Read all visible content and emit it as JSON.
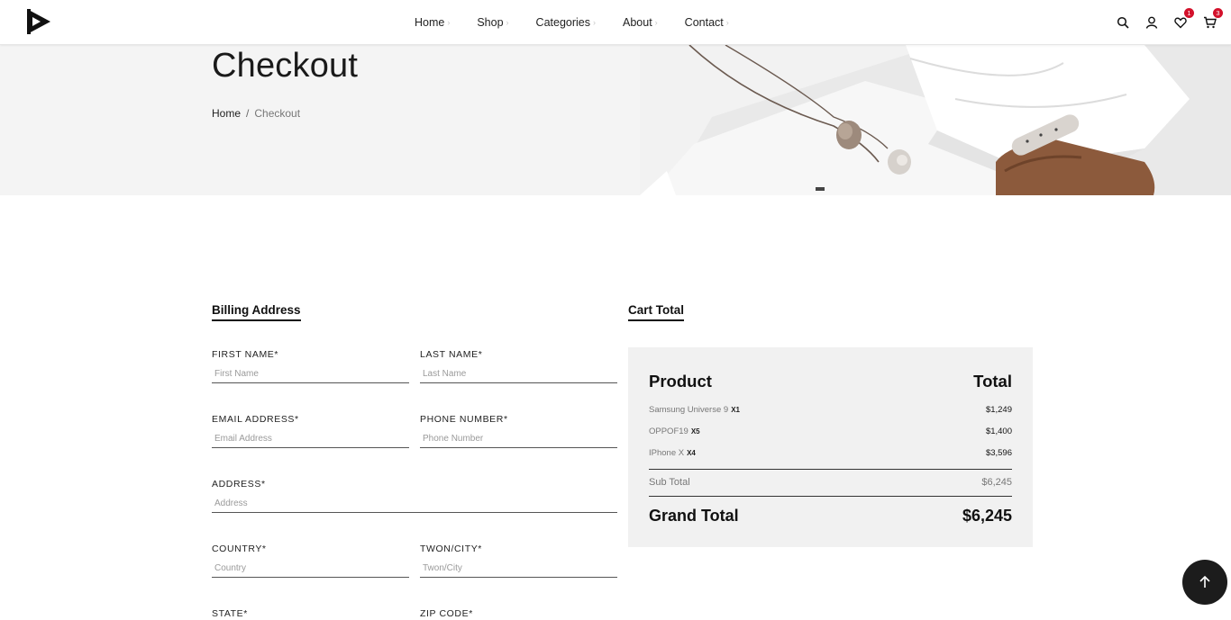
{
  "header": {
    "nav": [
      {
        "label": "Home"
      },
      {
        "label": "Shop"
      },
      {
        "label": "Categories"
      },
      {
        "label": "About"
      },
      {
        "label": "Contact"
      }
    ],
    "icons": [
      "search-icon",
      "user-icon",
      "heart-icon",
      "cart-icon"
    ],
    "wishlist_count": "1",
    "cart_count": "3"
  },
  "banner": {
    "title": "Checkout",
    "breadcrumb": {
      "home": "Home",
      "separator": "/",
      "current": "Checkout"
    }
  },
  "billing": {
    "title": "Billing Address",
    "fields": {
      "first_name": {
        "label": "FIRST NAME*",
        "placeholder": "First Name"
      },
      "last_name": {
        "label": "LAST NAME*",
        "placeholder": "Last Name"
      },
      "email": {
        "label": "EMAIL ADDRESS*",
        "placeholder": "Email Address"
      },
      "phone": {
        "label": "PHONE NUMBER*",
        "placeholder": "Phone Number"
      },
      "address": {
        "label": "ADDRESS*",
        "placeholder": "Address"
      },
      "country": {
        "label": "COUNTRY*",
        "placeholder": "Country"
      },
      "city": {
        "label": "TWON/CITY*",
        "placeholder": "Twon/City"
      },
      "state": {
        "label": "STATE*"
      },
      "zip": {
        "label": "ZIP CODE*"
      }
    }
  },
  "cart": {
    "title": "Cart Total",
    "col_product": "Product",
    "col_total": "Total",
    "items": [
      {
        "name": "Samsung Universe 9",
        "qty": "X1",
        "price": "$1,249"
      },
      {
        "name": "OPPOF19",
        "qty": "X5",
        "price": "$1,400"
      },
      {
        "name": "IPhone X",
        "qty": "X4",
        "price": "$3,596"
      }
    ],
    "sub_total_label": "Sub Total",
    "sub_total": "$6,245",
    "grand_total_label": "Grand Total",
    "grand_total": "$6,245"
  },
  "colors": {
    "accent": "#111111",
    "badge": "#d3112b",
    "panel": "#f1f1f1",
    "banner": "#f4f4f4"
  }
}
